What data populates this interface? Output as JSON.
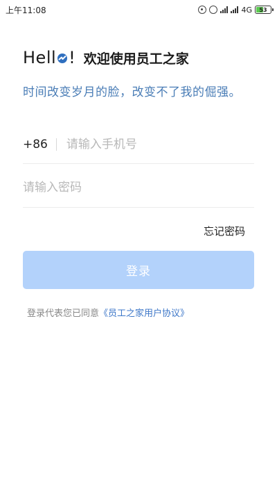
{
  "status_bar": {
    "time": "上午11:08",
    "network_label": "4G",
    "battery_level": "53",
    "battery_percent": 53,
    "battery_color": "#5ac94f"
  },
  "header": {
    "hello_prefix": "Hell",
    "hello_suffix": "!",
    "welcome": "欢迎使用员工之家",
    "slogan": "时间改变岁月的脸，改变不了我的倔强。"
  },
  "form": {
    "country_code": "+86",
    "phone_placeholder": "请输入手机号",
    "phone_value": "",
    "password_placeholder": "请输入密码",
    "password_value": "",
    "forgot_label": "忘记密码",
    "login_label": "登录"
  },
  "agreement": {
    "prefix": "登录代表您已同意",
    "link": "《员工之家用户协议》"
  },
  "colors": {
    "accent": "#4a7db6",
    "link": "#3d77c8",
    "button_disabled": "#b3d2fb"
  },
  "icons": [
    "hotspot-icon",
    "alarm-icon",
    "signal-icon",
    "battery-icon",
    "globe-icon"
  ]
}
